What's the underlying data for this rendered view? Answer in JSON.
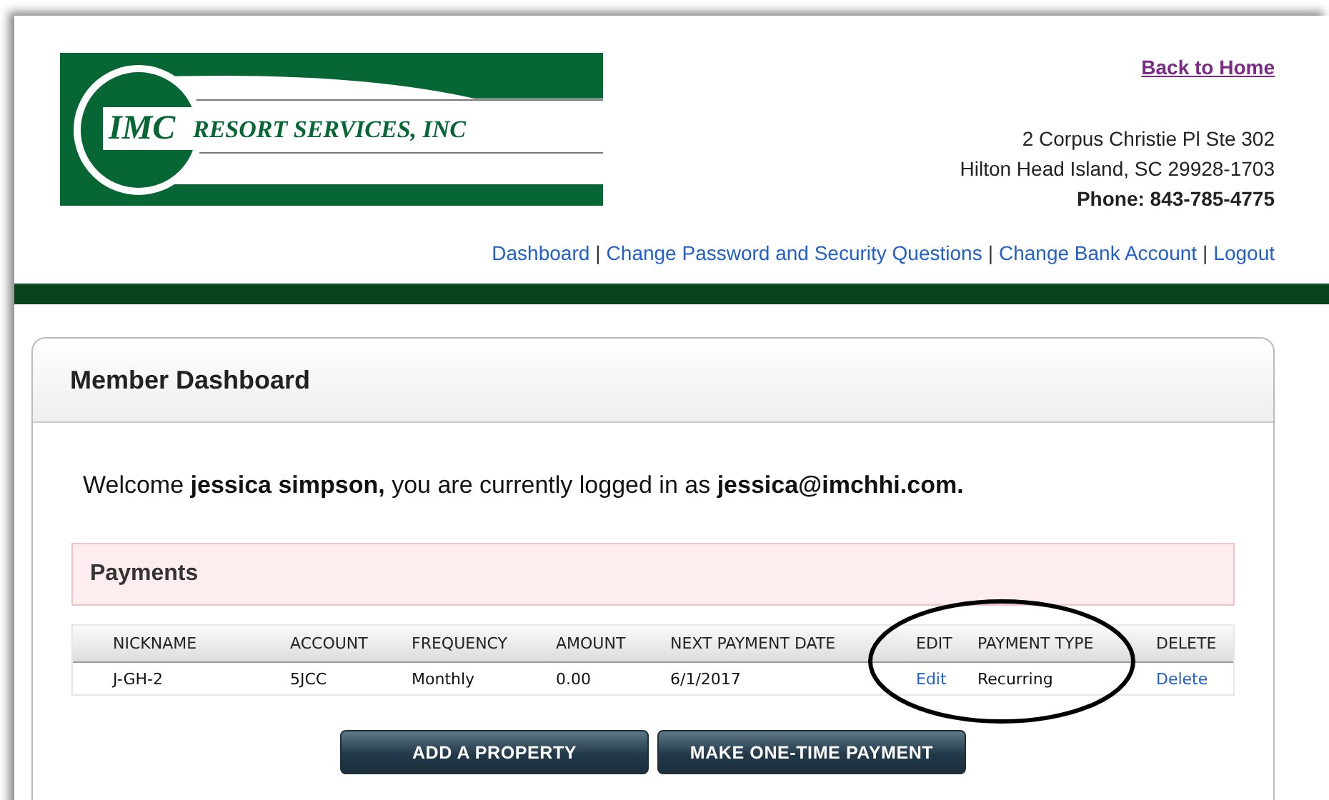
{
  "logo": {
    "mark": "IMC",
    "name": "RESORT SERVICES, INC"
  },
  "header": {
    "home_link": "Back to Home",
    "address": [
      "2 Corpus Christie Pl Ste 302",
      "Hilton Head Island, SC 29928-1703"
    ],
    "phone": "Phone: 843-785-4775"
  },
  "nav": [
    {
      "label": "Dashboard"
    },
    {
      "separator": "|",
      "label": "Change Password and Security Questions"
    },
    {
      "separator": "|",
      "label": "Change Bank Account"
    },
    {
      "separator": "|",
      "label": "Logout"
    }
  ],
  "panel": {
    "title": "Member Dashboard",
    "welcome": "Welcome **jessica simpson,** you are currently logged in as **jessica@imchhi.com.**"
  },
  "payments": {
    "title": "Payments",
    "columns": [
      "NICKNAME",
      "ACCOUNT",
      "FREQUENCY",
      "AMOUNT",
      "NEXT PAYMENT DATE",
      "EDIT",
      "PAYMENT TYPE",
      "DELETE"
    ],
    "rows": [
      [
        {
          "kind": "text",
          "text": "J-GH-2"
        },
        {
          "kind": "text",
          "text": "5JCC"
        },
        {
          "kind": "text",
          "text": "Monthly"
        },
        {
          "kind": "text",
          "text": "0.00"
        },
        {
          "kind": "text",
          "text": "6/1/2017"
        },
        {
          "kind": "link",
          "text": "Edit"
        },
        {
          "kind": "text",
          "text": "Recurring"
        },
        {
          "kind": "link",
          "text": "Delete"
        }
      ]
    ]
  },
  "buttons": [
    "ADD A PROPERTY",
    "MAKE ONE-TIME PAYMENT"
  ],
  "annotation": {
    "kind": "ellipse"
  }
}
